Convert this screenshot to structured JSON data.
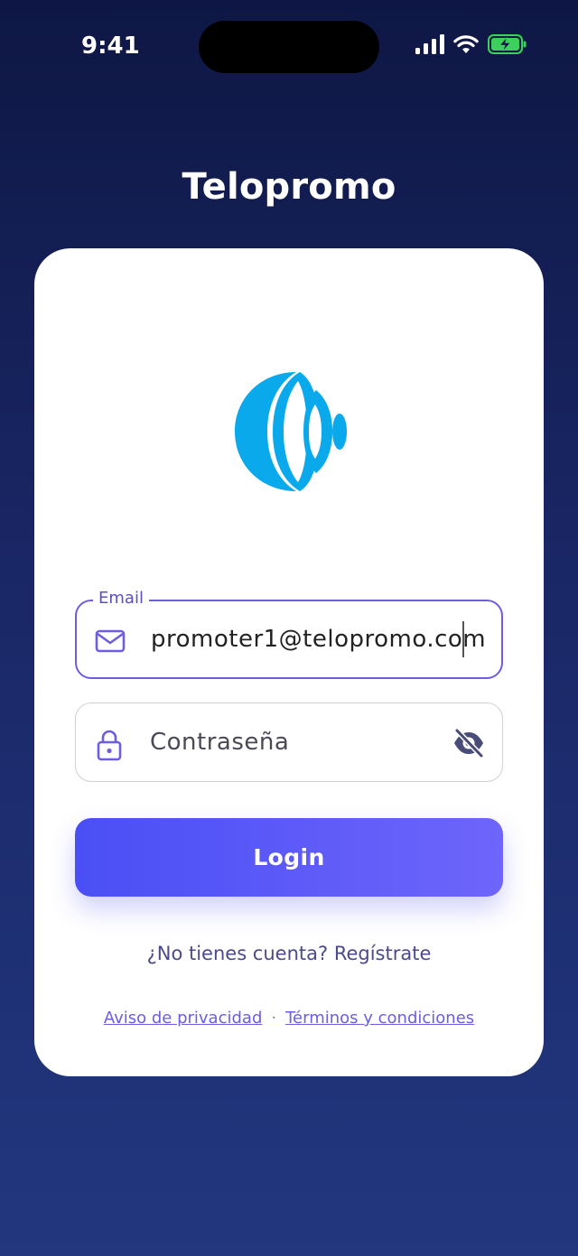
{
  "status_bar": {
    "time": "9:41",
    "icons": [
      "signal-icon",
      "wifi-icon",
      "battery-charging-icon"
    ]
  },
  "app": {
    "title": "Telopromo",
    "logo": "telopromo-logo",
    "accent_color": "#6d5ee0",
    "logo_color": "#09a9ec"
  },
  "form": {
    "email": {
      "label": "Email",
      "value": "promoter1@telopromo.com",
      "icon": "mail-icon"
    },
    "password": {
      "placeholder": "Contraseña",
      "icon": "lock-icon",
      "toggle_icon": "eye-off-icon"
    },
    "login_label": "Login",
    "register_text": "¿No tienes cuenta? Regístrate"
  },
  "legal": {
    "privacy": "Aviso de privacidad",
    "separator": "·",
    "terms": "Términos y condiciones"
  }
}
